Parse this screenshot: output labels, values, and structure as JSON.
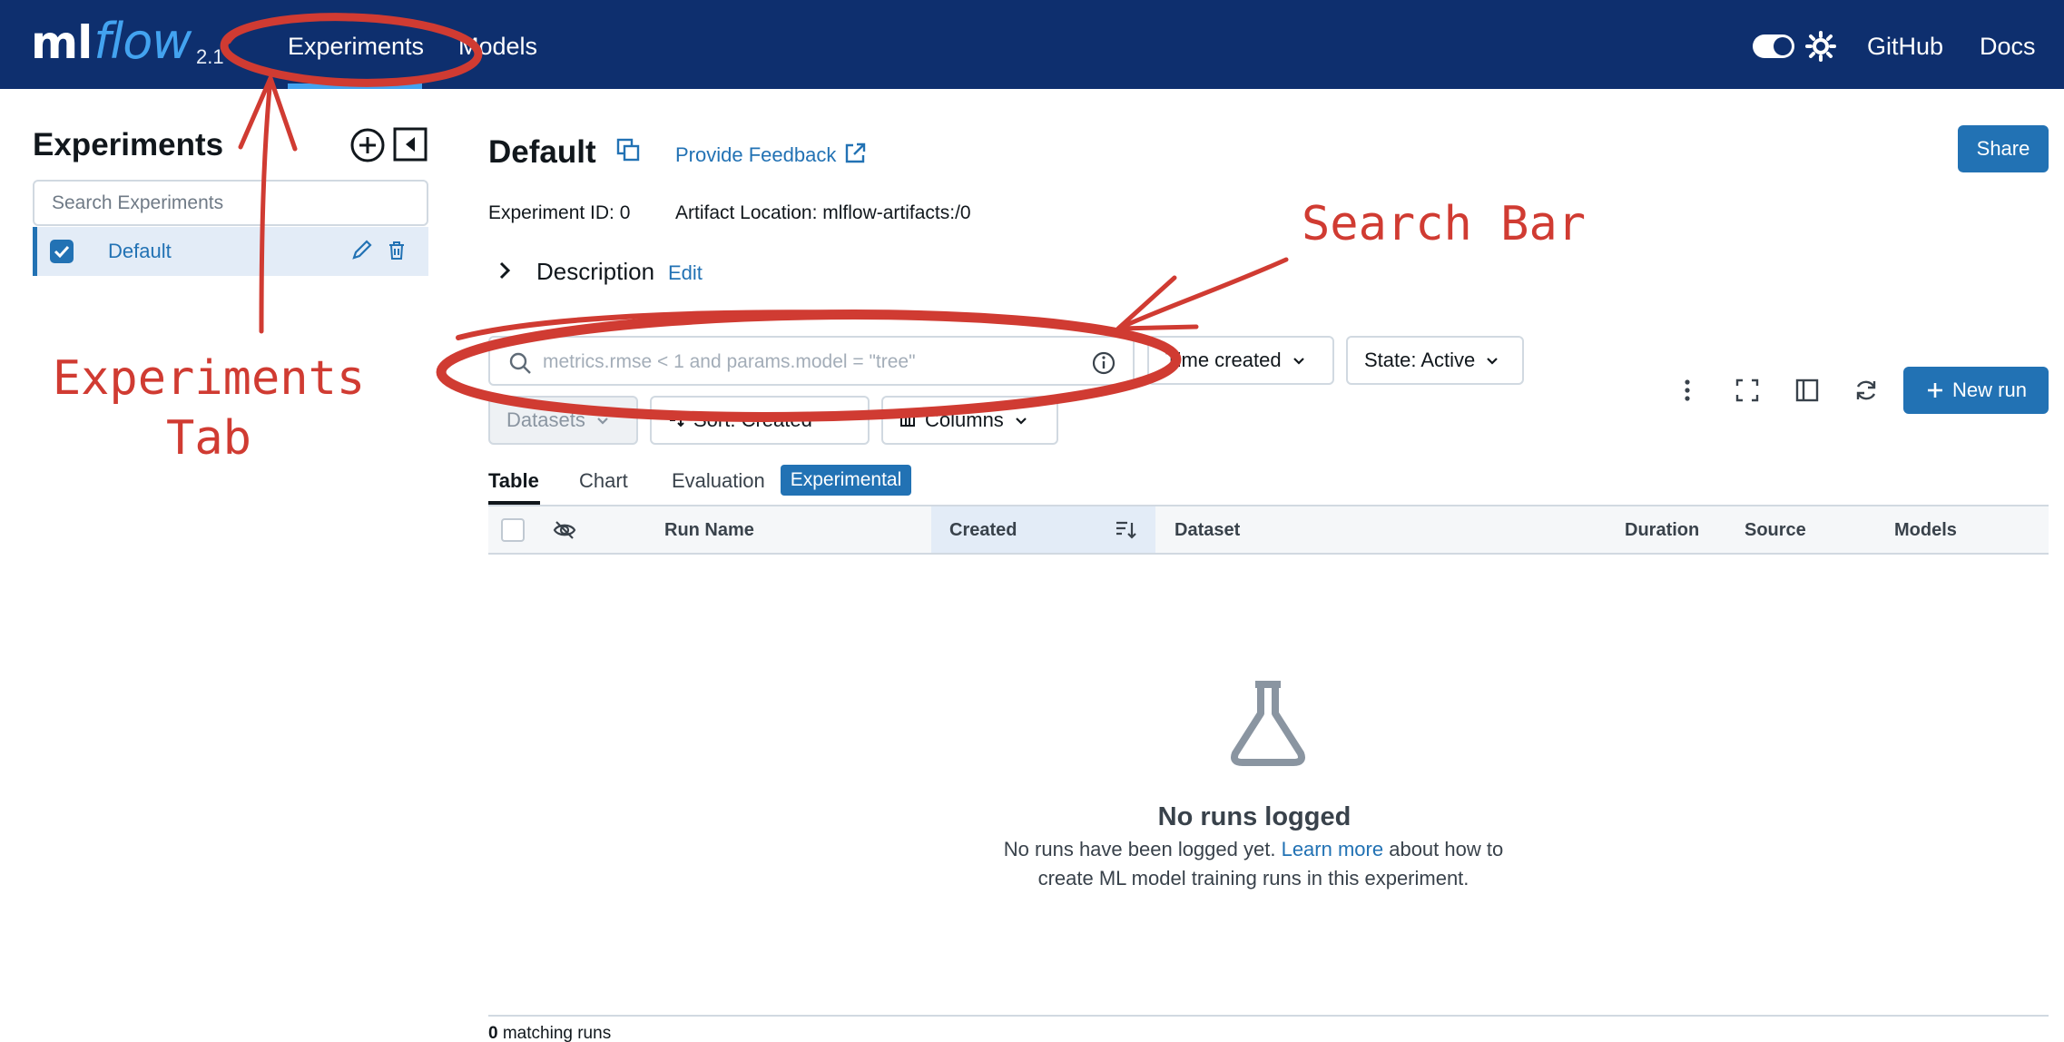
{
  "nav": {
    "logo_ml": "ml",
    "logo_flow": "flow",
    "version": "2.1",
    "items": [
      "Experiments",
      "Models"
    ],
    "right": [
      "GitHub",
      "Docs"
    ]
  },
  "sidebar": {
    "title": "Experiments",
    "search_placeholder": "Search Experiments",
    "experiments": [
      {
        "name": "Default",
        "checked": true
      }
    ]
  },
  "header": {
    "title": "Default",
    "feedback": "Provide Feedback",
    "share": "Share",
    "experiment_id": "Experiment ID: 0",
    "artifact_location": "Artifact Location: mlflow-artifacts:/0",
    "description_label": "Description",
    "description_edit": "Edit"
  },
  "filters": {
    "search_placeholder": "metrics.rmse < 1 and params.model = \"tree\"",
    "time": "Time created",
    "state": "State: Active",
    "datasets": "Datasets",
    "sort": "Sort: Created",
    "columns": "Columns",
    "new_run": "New run"
  },
  "tabs": {
    "table": "Table",
    "chart": "Chart",
    "evaluation": "Evaluation",
    "badge": "Experimental"
  },
  "table": {
    "headers": [
      "Run Name",
      "Created",
      "Dataset",
      "Duration",
      "Source",
      "Models"
    ]
  },
  "empty": {
    "title": "No runs logged",
    "line1_pre": "No runs have been logged yet.",
    "link": "Learn more",
    "line1_post": "about how to",
    "line2": "create ML model training runs in this experiment."
  },
  "footer": {
    "count": "0",
    "label": "matching runs"
  },
  "annotations": {
    "experiments_tab": [
      "Experiments",
      "Tab"
    ],
    "search_bar": "Search Bar",
    "color": "#d03b32"
  },
  "colors": {
    "nav_bg": "#0e2f6e",
    "accent": "#2272b4",
    "logo_flow": "#43a3f0"
  }
}
